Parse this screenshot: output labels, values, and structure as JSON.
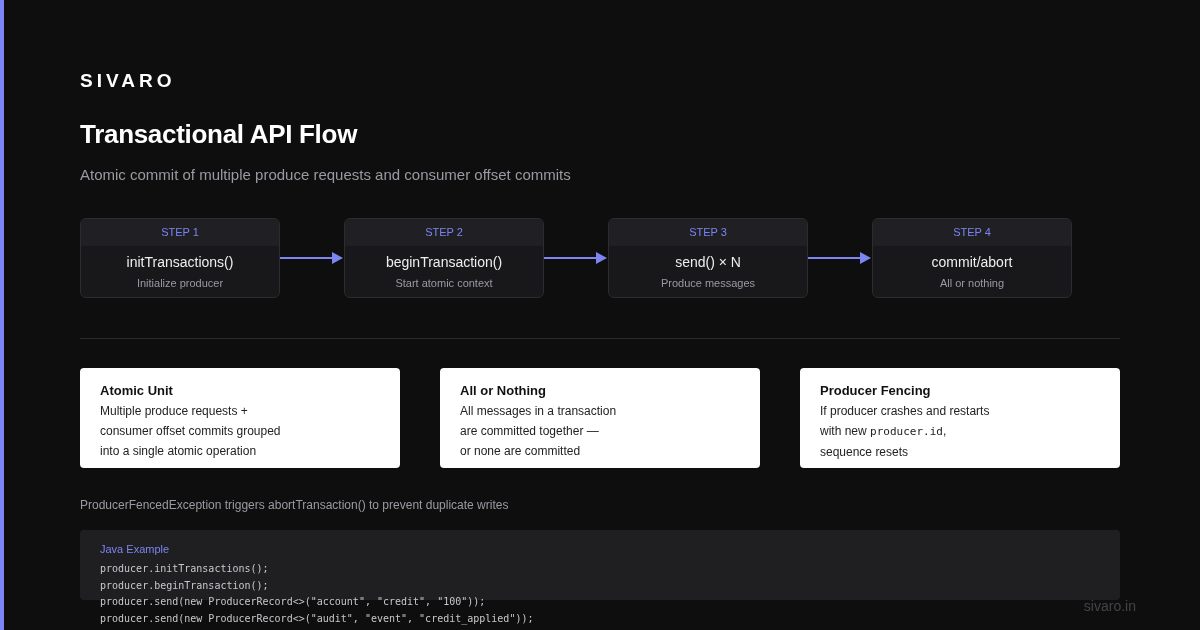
{
  "brand": "SIVARO",
  "title": "Transactional API Flow",
  "subtitle": "Atomic commit of multiple produce requests and consumer offset commits",
  "steps": [
    {
      "label": "STEP 1",
      "call": "initTransactions()",
      "description": "Initialize producer"
    },
    {
      "label": "STEP 2",
      "call": "beginTransaction()",
      "description": "Start atomic context"
    },
    {
      "label": "STEP 3",
      "call": "send() × N",
      "description": "Produce messages"
    },
    {
      "label": "STEP 4",
      "call": "commit/abort",
      "description": "All or nothing"
    }
  ],
  "cards": [
    {
      "title": "Atomic Unit",
      "lines": [
        "Multiple produce requests +",
        "consumer offset commits grouped",
        "into a single atomic operation"
      ]
    },
    {
      "title": "All or Nothing",
      "lines": [
        "All messages in a transaction",
        "are committed together —",
        "or none are committed"
      ]
    },
    {
      "title": "Producer Fencing",
      "lines": [
        "If producer crashes and restarts",
        {
          "parts": [
            {
              "kind": "plain",
              "text": "with new"
            },
            {
              "kind": "code",
              "text": "producer.id"
            },
            {
              "kind": "plain",
              "text": ","
            }
          ]
        },
        "sequence resets"
      ]
    }
  ],
  "note": "ProducerFencedException triggers abortTransaction() to prevent duplicate writes",
  "code": {
    "label": "Java Example",
    "lines": [
      "producer.initTransactions();",
      "producer.beginTransaction();",
      "producer.send(new ProducerRecord<>(\"account\", \"credit\", \"100\"));",
      "producer.send(new ProducerRecord<>(\"audit\", \"event\", \"credit_applied\"));"
    ]
  },
  "footer": "sivaro.in"
}
